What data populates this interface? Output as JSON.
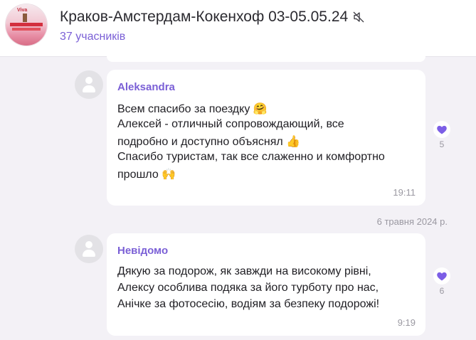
{
  "header": {
    "title": "Краков-Амстердам-Кокенхоф 03-05.05.24",
    "members": "37 учасників",
    "avatar_logo_text": "Viva",
    "mute_icon": "muted-speaker-icon"
  },
  "date_separator": "6 травня 2024 р.",
  "messages": [
    {
      "sender": "Aleksandra",
      "lines": [
        "Всем спасибо за поездку 🤗",
        "Алексей - отличный сопровождающий, все",
        "подробно и доступно объяснял 👍",
        "Спасибо туристам, так все слаженно и комфортно",
        "прошло 🙌"
      ],
      "time": "19:11",
      "reaction": {
        "icon": "heart-icon",
        "count": "5"
      }
    },
    {
      "sender": "Невідомо",
      "lines": [
        "Дякую за подорож, як завжди на високому рівні,",
        "Алексу особлива подяка за його турботу про нас,",
        "Анічке за фотосесію, водіям за безпеку подорожі!"
      ],
      "time": "9:19",
      "reaction": {
        "icon": "heart-icon",
        "count": "6"
      }
    }
  ],
  "colors": {
    "accent": "#7a5fd6",
    "heart": "#7c5ee6",
    "background": "#f3f1f6"
  }
}
